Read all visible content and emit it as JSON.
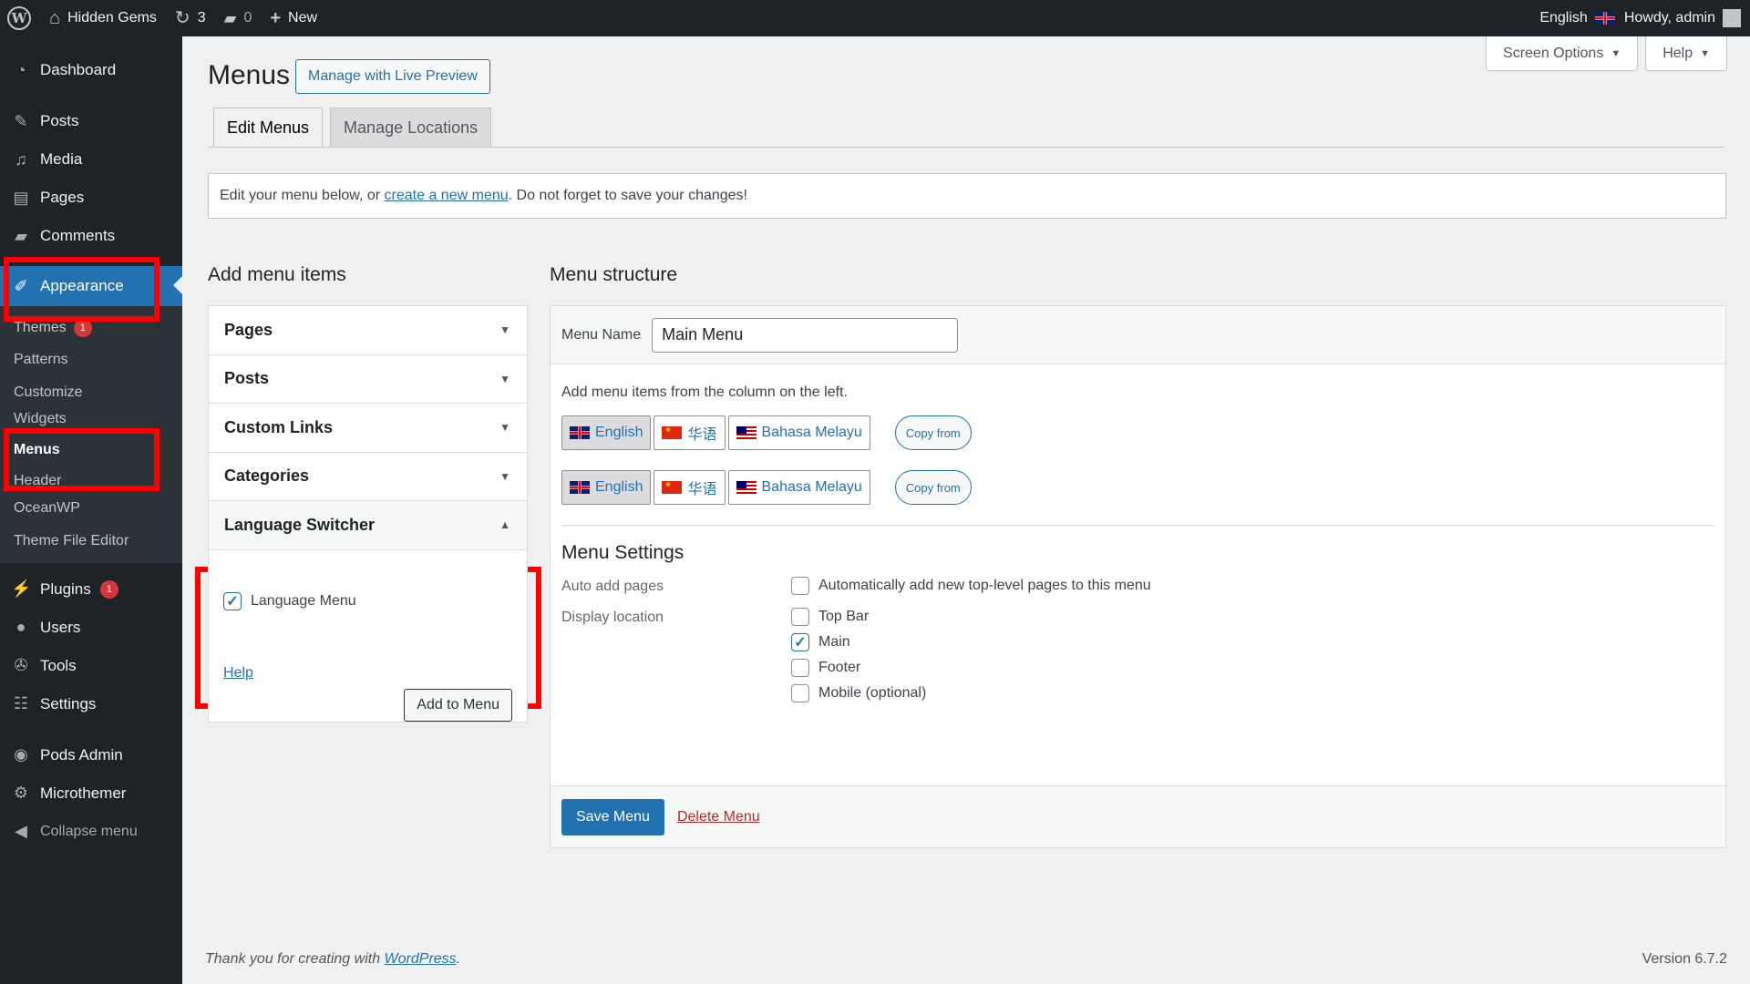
{
  "adminbar": {
    "site_name": "Hidden Gems",
    "updates_count": "3",
    "comments_count": "0",
    "new_label": "New",
    "language": "English",
    "howdy": "Howdy, admin"
  },
  "sidebar": {
    "dashboard": "Dashboard",
    "posts": "Posts",
    "media": "Media",
    "pages": "Pages",
    "comments": "Comments",
    "appearance": "Appearance",
    "sub": {
      "themes": "Themes",
      "themes_badge": "1",
      "patterns": "Patterns",
      "customize": "Customize",
      "widgets": "Widgets",
      "menus": "Menus",
      "header": "Header",
      "oceanwp": "OceanWP",
      "theme_file_editor": "Theme File Editor"
    },
    "plugins": "Plugins",
    "plugins_badge": "1",
    "users": "Users",
    "tools": "Tools",
    "settings": "Settings",
    "pods_admin": "Pods Admin",
    "microthemer": "Microthemer",
    "collapse": "Collapse menu"
  },
  "screen_meta": {
    "screen_options": "Screen Options",
    "help": "Help"
  },
  "page": {
    "title": "Menus",
    "live_preview": "Manage with Live Preview",
    "tabs": [
      "Edit Menus",
      "Manage Locations"
    ],
    "notice_prefix": "Edit your menu below, or ",
    "notice_link": "create a new menu",
    "notice_suffix": ". Do not forget to save your changes!"
  },
  "add_items": {
    "title": "Add menu items",
    "sections": [
      "Pages",
      "Posts",
      "Custom Links",
      "Categories",
      "Language Switcher"
    ],
    "language_menu_label": "Language Menu",
    "help": "Help",
    "add_to_menu": "Add to Menu"
  },
  "structure": {
    "title": "Menu structure",
    "menu_name_label": "Menu Name",
    "menu_name_value": "Main Menu",
    "hint": "Add menu items from the column on the left.",
    "languages": [
      "English",
      "华语",
      "Bahasa Melayu"
    ],
    "copy_from": "Copy from",
    "settings_title": "Menu Settings",
    "auto_add_label": "Auto add pages",
    "auto_add_option": "Automatically add new top-level pages to this menu",
    "display_location_label": "Display location",
    "locations": [
      "Top Bar",
      "Main",
      "Footer",
      "Mobile (optional)"
    ],
    "save": "Save Menu",
    "delete": "Delete Menu"
  },
  "footer": {
    "thanks_prefix": "Thank you for creating with ",
    "thanks_link": "WordPress",
    "thanks_suffix": ".",
    "version": "Version 6.7.2"
  },
  "colors": {
    "admin_dark": "#1d2327",
    "primary_blue": "#2271b1",
    "highlight_red": "#ff0000",
    "delete_red": "#b32d2e"
  }
}
